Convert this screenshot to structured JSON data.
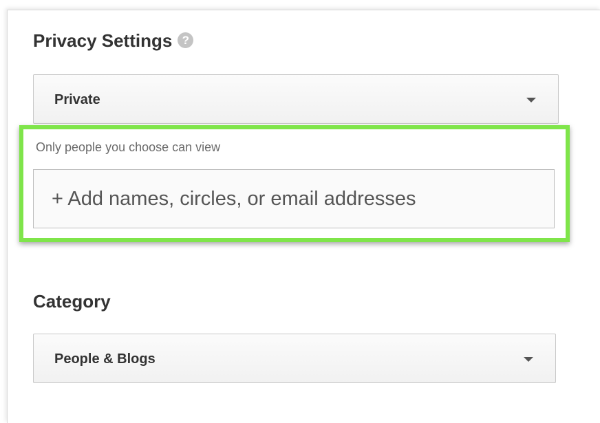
{
  "privacy": {
    "title": "Privacy Settings",
    "help_icon": "question-mark-icon",
    "help_glyph": "?",
    "selected": "Private",
    "helper_text": "Only people you choose can view",
    "share_placeholder": "+ Add names, circles, or email addresses"
  },
  "category": {
    "title": "Category",
    "selected": "People & Blogs"
  },
  "colors": {
    "highlight": "#7fe54a",
    "help_icon": "#c4c4c4",
    "title_text": "#333333",
    "helper_text": "#6b6b6b"
  }
}
